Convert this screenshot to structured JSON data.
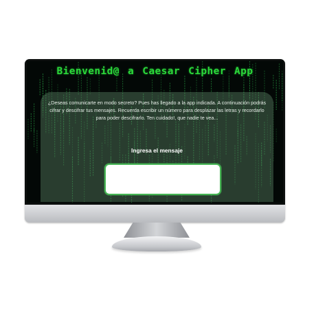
{
  "app": {
    "title": "Bienvenid@ a Caesar Cipher App",
    "intro": "¿Deseas comunicarte en modo secreto? Pues has llegado a la app indicada. A continuación podrás cifrar y descifrar tus mensajes. Recuerda escribir un número para desplazar las letras y recordarlo para poder descifrarlo. Ten cuidado!, que nadie te vea...",
    "message_label": "Ingresa el mensaje",
    "message_value": ""
  },
  "colors": {
    "screen_bg": "#030806",
    "title": "#2bd83a",
    "rain": "#1f7a35",
    "input_border": "#46b554"
  }
}
